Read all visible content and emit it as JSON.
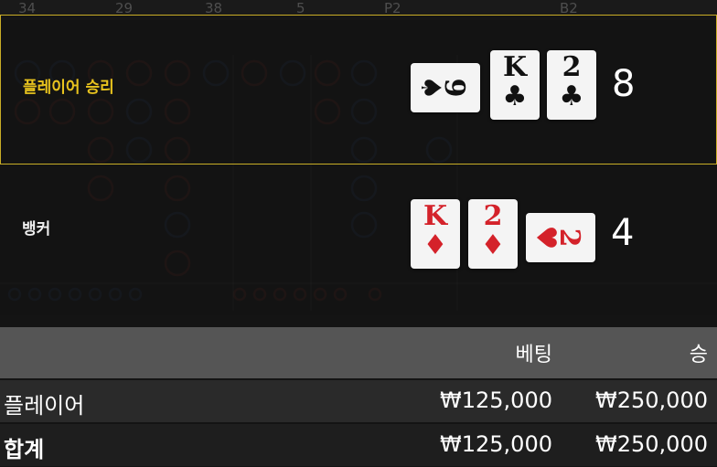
{
  "top_strip": {
    "items": [
      "34",
      "29",
      "38",
      "5",
      "P2",
      "B2"
    ]
  },
  "player": {
    "label": "플레이어 승리",
    "score": "8",
    "cards": [
      {
        "rank": "9",
        "suit": "♠",
        "color": "black",
        "orientation": "sideways"
      },
      {
        "rank": "K",
        "suit": "♣",
        "color": "black",
        "orientation": "upright"
      },
      {
        "rank": "2",
        "suit": "♣",
        "color": "black",
        "orientation": "upright"
      }
    ]
  },
  "banker": {
    "label": "뱅커",
    "score": "4",
    "cards": [
      {
        "rank": "K",
        "suit": "♦",
        "color": "red",
        "orientation": "upright"
      },
      {
        "rank": "2",
        "suit": "♦",
        "color": "red",
        "orientation": "upright"
      },
      {
        "rank": "2",
        "suit": "♥",
        "color": "red",
        "orientation": "sideways"
      }
    ]
  },
  "summary": {
    "header": {
      "bet": "베팅",
      "win": "승"
    },
    "rows": [
      {
        "label": "플레이어",
        "bet": "₩125,000",
        "win": "₩250,000"
      },
      {
        "label": "합계",
        "bet": "₩125,000",
        "win": "₩250,000"
      }
    ]
  },
  "colors": {
    "accent": "#c9ad26",
    "player_label": "#e8c31e",
    "red_suit": "#d4222a",
    "header_bg": "#555555"
  }
}
